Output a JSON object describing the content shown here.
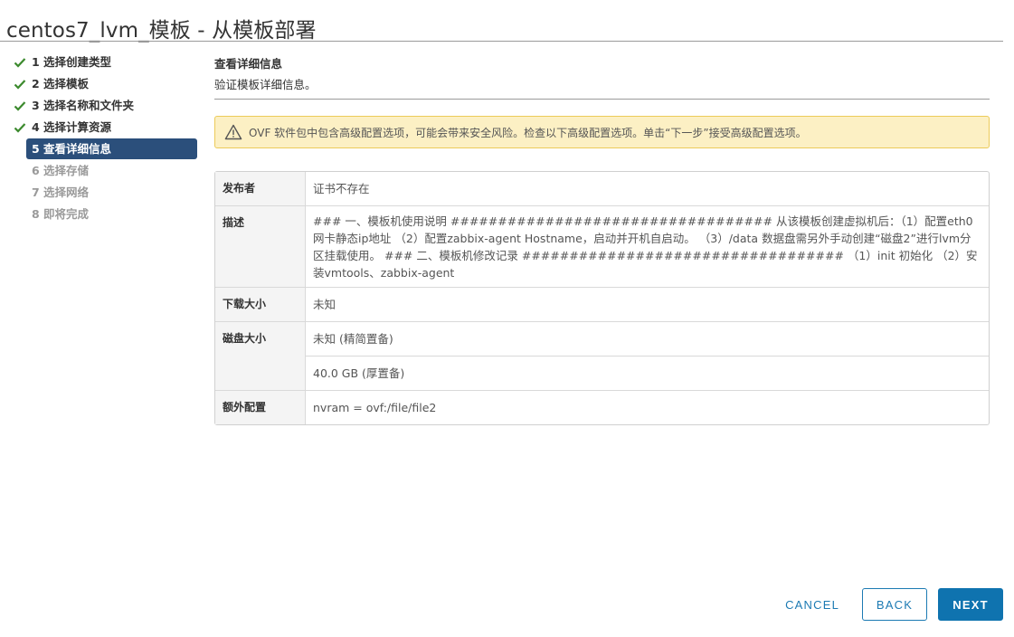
{
  "window": {
    "title": "centos7_lvm_模板 - 从模板部署"
  },
  "steps": [
    {
      "label": "1 选择创建类型",
      "state": "done",
      "icon": "check-icon"
    },
    {
      "label": "2 选择模板",
      "state": "done",
      "icon": "check-icon"
    },
    {
      "label": "3 选择名称和文件夹",
      "state": "done",
      "icon": "check-icon"
    },
    {
      "label": "4 选择计算资源",
      "state": "done",
      "icon": "check-icon"
    },
    {
      "label": "5 查看详细信息",
      "state": "active"
    },
    {
      "label": "6 选择存储",
      "state": "todo"
    },
    {
      "label": "7 选择网络",
      "state": "todo"
    },
    {
      "label": "8 即将完成",
      "state": "todo"
    }
  ],
  "main": {
    "title": "查看详细信息",
    "subtitle": "验证模板详细信息。",
    "warning": {
      "icon": "warning-triangle-icon",
      "text": "OVF 软件包中包含高级配置选项，可能会带来安全风险。检查以下高级配置选项。单击“下一步”接受高级配置选项。"
    }
  },
  "details": {
    "publisher_label": "发布者",
    "publisher_value": "证书不存在",
    "description_label": "描述",
    "description_value": "### 一、模板机使用说明 ################################## 从该模板创建虚拟机后：（1）配置eth0网卡静态ip地址 （2）配置zabbix-agent Hostname，启动并开机自启动。 （3）/data 数据盘需另外手动创建“磁盘2”进行lvm分区挂载使用。 ### 二、模板机修改记录 ##################################  （1）init 初始化 （2）安装vmtools、zabbix-agent",
    "download_size_label": "下载大小",
    "download_size_value": "未知",
    "disk_size_label": "磁盘大小",
    "disk_size_values": [
      "未知 (精简置备)",
      "40.0 GB (厚置备)"
    ],
    "extra_config_label": "额外配置",
    "extra_config_value": "nvram = ovf:/file/file2"
  },
  "footer": {
    "cancel_label": "CANCEL",
    "back_label": "BACK",
    "next_label": "NEXT"
  },
  "colors": {
    "active_step_bg": "#2b4f7b",
    "check_green": "#3c8a2e",
    "warning_bg": "#fcf0c4",
    "warning_border": "#eccb5a",
    "primary_button": "#0f73af"
  }
}
